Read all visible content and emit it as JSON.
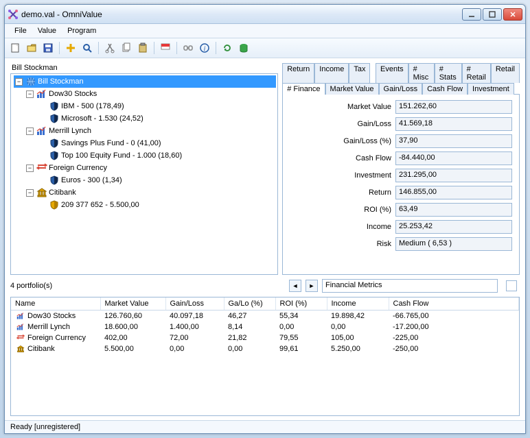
{
  "window": {
    "title": "demo.val - OmniValue"
  },
  "menu": {
    "file": "File",
    "value": "Value",
    "program": "Program"
  },
  "tree": {
    "owner": "Bill Stockman",
    "root": "Bill Stockman",
    "dow30": "Dow30 Stocks",
    "ibm": "IBM - 500 (178,49)",
    "microsoft": "Microsoft - 1.530 (24,52)",
    "merrill": "Merrill Lynch",
    "savings": "Savings Plus Fund - 0 (41,00)",
    "top100": "Top 100 Equity Fund - 1.000 (18,60)",
    "foreign": "Foreign Currency",
    "euros": "Euros - 300 (1,34)",
    "citibank": "Citibank",
    "account": "209 377 652 - 5.500,00"
  },
  "tabs_top": {
    "return": "Return",
    "income": "Income",
    "tax": "Tax",
    "events": "Events",
    "misc": "# Misc",
    "stats": "# Stats",
    "retailhash": "# Retail",
    "retail": "Retail"
  },
  "tabs_bot": {
    "finance": "# Finance",
    "mv": "Market Value",
    "gl": "Gain/Loss",
    "cf": "Cash Flow",
    "inv": "Investment"
  },
  "fields": {
    "mv_l": "Market Value",
    "mv_v": "151.262,60",
    "gl_l": "Gain/Loss",
    "gl_v": "41.569,18",
    "glp_l": "Gain/Loss (%)",
    "glp_v": "37,90",
    "cf_l": "Cash Flow",
    "cf_v": "-84.440,00",
    "inv_l": "Investment",
    "inv_v": "231.295,00",
    "ret_l": "Return",
    "ret_v": "146.855,00",
    "roi_l": "ROI (%)",
    "roi_v": "63,49",
    "inc_l": "Income",
    "inc_v": "25.253,42",
    "risk_l": "Risk",
    "risk_v": "Medium  ( 6,53 )"
  },
  "metrics_label": "Financial Metrics",
  "portfolio_count": "4 portfolio(s)",
  "table": {
    "headers": {
      "name": "Name",
      "mv": "Market Value",
      "gl": "Gain/Loss",
      "glp": "Ga/Lo (%)",
      "roi": "ROI (%)",
      "inc": "Income",
      "cf": "Cash Flow"
    },
    "rows": [
      {
        "name": "Dow30 Stocks",
        "mv": "126.760,60",
        "gl": "40.097,18",
        "glp": "46,27",
        "roi": "55,34",
        "inc": "19.898,42",
        "cf": "-66.765,00",
        "icon": "chart"
      },
      {
        "name": "Merrill Lynch",
        "mv": "18.600,00",
        "gl": "1.400,00",
        "glp": "8,14",
        "roi": "0,00",
        "inc": "0,00",
        "cf": "-17.200,00",
        "icon": "chart"
      },
      {
        "name": "Foreign Currency",
        "mv": "402,00",
        "gl": "72,00",
        "glp": "21,82",
        "roi": "79,55",
        "inc": "105,00",
        "cf": "-225,00",
        "icon": "currency"
      },
      {
        "name": "Citibank",
        "mv": "5.500,00",
        "gl": "0,00",
        "glp": "0,00",
        "roi": "99,61",
        "inc": "5.250,00",
        "cf": "-250,00",
        "icon": "bank"
      }
    ]
  },
  "status": "Ready [unregistered]"
}
